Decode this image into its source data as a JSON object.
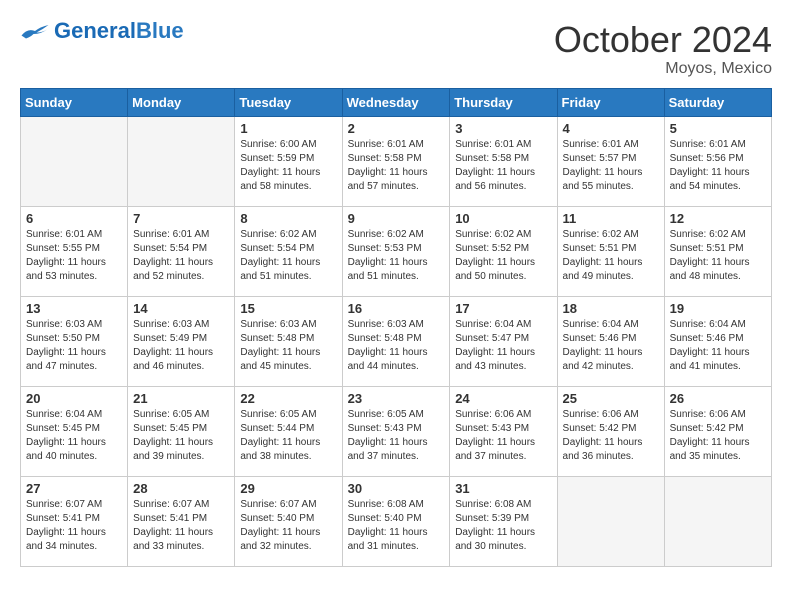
{
  "header": {
    "logo_general": "General",
    "logo_blue": "Blue",
    "month_title": "October 2024",
    "location": "Moyos, Mexico"
  },
  "weekdays": [
    "Sunday",
    "Monday",
    "Tuesday",
    "Wednesday",
    "Thursday",
    "Friday",
    "Saturday"
  ],
  "days": [
    {
      "num": "",
      "sunrise": "",
      "sunset": "",
      "daylight": "",
      "empty": true
    },
    {
      "num": "",
      "sunrise": "",
      "sunset": "",
      "daylight": "",
      "empty": true
    },
    {
      "num": "1",
      "sunrise": "Sunrise: 6:00 AM",
      "sunset": "Sunset: 5:59 PM",
      "daylight": "Daylight: 11 hours and 58 minutes."
    },
    {
      "num": "2",
      "sunrise": "Sunrise: 6:01 AM",
      "sunset": "Sunset: 5:58 PM",
      "daylight": "Daylight: 11 hours and 57 minutes."
    },
    {
      "num": "3",
      "sunrise": "Sunrise: 6:01 AM",
      "sunset": "Sunset: 5:58 PM",
      "daylight": "Daylight: 11 hours and 56 minutes."
    },
    {
      "num": "4",
      "sunrise": "Sunrise: 6:01 AM",
      "sunset": "Sunset: 5:57 PM",
      "daylight": "Daylight: 11 hours and 55 minutes."
    },
    {
      "num": "5",
      "sunrise": "Sunrise: 6:01 AM",
      "sunset": "Sunset: 5:56 PM",
      "daylight": "Daylight: 11 hours and 54 minutes."
    },
    {
      "num": "6",
      "sunrise": "Sunrise: 6:01 AM",
      "sunset": "Sunset: 5:55 PM",
      "daylight": "Daylight: 11 hours and 53 minutes."
    },
    {
      "num": "7",
      "sunrise": "Sunrise: 6:01 AM",
      "sunset": "Sunset: 5:54 PM",
      "daylight": "Daylight: 11 hours and 52 minutes."
    },
    {
      "num": "8",
      "sunrise": "Sunrise: 6:02 AM",
      "sunset": "Sunset: 5:54 PM",
      "daylight": "Daylight: 11 hours and 51 minutes."
    },
    {
      "num": "9",
      "sunrise": "Sunrise: 6:02 AM",
      "sunset": "Sunset: 5:53 PM",
      "daylight": "Daylight: 11 hours and 51 minutes."
    },
    {
      "num": "10",
      "sunrise": "Sunrise: 6:02 AM",
      "sunset": "Sunset: 5:52 PM",
      "daylight": "Daylight: 11 hours and 50 minutes."
    },
    {
      "num": "11",
      "sunrise": "Sunrise: 6:02 AM",
      "sunset": "Sunset: 5:51 PM",
      "daylight": "Daylight: 11 hours and 49 minutes."
    },
    {
      "num": "12",
      "sunrise": "Sunrise: 6:02 AM",
      "sunset": "Sunset: 5:51 PM",
      "daylight": "Daylight: 11 hours and 48 minutes."
    },
    {
      "num": "13",
      "sunrise": "Sunrise: 6:03 AM",
      "sunset": "Sunset: 5:50 PM",
      "daylight": "Daylight: 11 hours and 47 minutes."
    },
    {
      "num": "14",
      "sunrise": "Sunrise: 6:03 AM",
      "sunset": "Sunset: 5:49 PM",
      "daylight": "Daylight: 11 hours and 46 minutes."
    },
    {
      "num": "15",
      "sunrise": "Sunrise: 6:03 AM",
      "sunset": "Sunset: 5:48 PM",
      "daylight": "Daylight: 11 hours and 45 minutes."
    },
    {
      "num": "16",
      "sunrise": "Sunrise: 6:03 AM",
      "sunset": "Sunset: 5:48 PM",
      "daylight": "Daylight: 11 hours and 44 minutes."
    },
    {
      "num": "17",
      "sunrise": "Sunrise: 6:04 AM",
      "sunset": "Sunset: 5:47 PM",
      "daylight": "Daylight: 11 hours and 43 minutes."
    },
    {
      "num": "18",
      "sunrise": "Sunrise: 6:04 AM",
      "sunset": "Sunset: 5:46 PM",
      "daylight": "Daylight: 11 hours and 42 minutes."
    },
    {
      "num": "19",
      "sunrise": "Sunrise: 6:04 AM",
      "sunset": "Sunset: 5:46 PM",
      "daylight": "Daylight: 11 hours and 41 minutes."
    },
    {
      "num": "20",
      "sunrise": "Sunrise: 6:04 AM",
      "sunset": "Sunset: 5:45 PM",
      "daylight": "Daylight: 11 hours and 40 minutes."
    },
    {
      "num": "21",
      "sunrise": "Sunrise: 6:05 AM",
      "sunset": "Sunset: 5:45 PM",
      "daylight": "Daylight: 11 hours and 39 minutes."
    },
    {
      "num": "22",
      "sunrise": "Sunrise: 6:05 AM",
      "sunset": "Sunset: 5:44 PM",
      "daylight": "Daylight: 11 hours and 38 minutes."
    },
    {
      "num": "23",
      "sunrise": "Sunrise: 6:05 AM",
      "sunset": "Sunset: 5:43 PM",
      "daylight": "Daylight: 11 hours and 37 minutes."
    },
    {
      "num": "24",
      "sunrise": "Sunrise: 6:06 AM",
      "sunset": "Sunset: 5:43 PM",
      "daylight": "Daylight: 11 hours and 37 minutes."
    },
    {
      "num": "25",
      "sunrise": "Sunrise: 6:06 AM",
      "sunset": "Sunset: 5:42 PM",
      "daylight": "Daylight: 11 hours and 36 minutes."
    },
    {
      "num": "26",
      "sunrise": "Sunrise: 6:06 AM",
      "sunset": "Sunset: 5:42 PM",
      "daylight": "Daylight: 11 hours and 35 minutes."
    },
    {
      "num": "27",
      "sunrise": "Sunrise: 6:07 AM",
      "sunset": "Sunset: 5:41 PM",
      "daylight": "Daylight: 11 hours and 34 minutes."
    },
    {
      "num": "28",
      "sunrise": "Sunrise: 6:07 AM",
      "sunset": "Sunset: 5:41 PM",
      "daylight": "Daylight: 11 hours and 33 minutes."
    },
    {
      "num": "29",
      "sunrise": "Sunrise: 6:07 AM",
      "sunset": "Sunset: 5:40 PM",
      "daylight": "Daylight: 11 hours and 32 minutes."
    },
    {
      "num": "30",
      "sunrise": "Sunrise: 6:08 AM",
      "sunset": "Sunset: 5:40 PM",
      "daylight": "Daylight: 11 hours and 31 minutes."
    },
    {
      "num": "31",
      "sunrise": "Sunrise: 6:08 AM",
      "sunset": "Sunset: 5:39 PM",
      "daylight": "Daylight: 11 hours and 30 minutes."
    },
    {
      "num": "",
      "sunrise": "",
      "sunset": "",
      "daylight": "",
      "empty": true
    },
    {
      "num": "",
      "sunrise": "",
      "sunset": "",
      "daylight": "",
      "empty": true
    }
  ]
}
